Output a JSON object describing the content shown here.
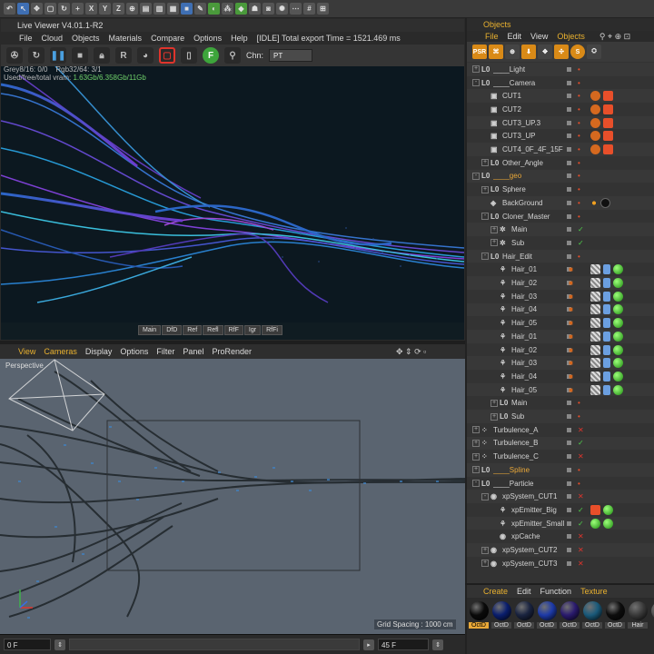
{
  "toolbar": {
    "xyz": [
      "X",
      "Y",
      "Z"
    ]
  },
  "live_viewer": {
    "title": "Live Viewer V4.01.1-R2",
    "menu": [
      "File",
      "Cloud",
      "Objects",
      "Materials",
      "Compare",
      "Options",
      "Help"
    ],
    "status": "[IDLE] Total export Time = 1521.469 ms",
    "channel_label": "Chn:",
    "channel_value": "PT",
    "stats": {
      "line1_a": "Grey8/16: 0/0",
      "line1_b": "Rgb32/64: 3/1",
      "vram_label": "Used/free/total vram:",
      "vram_value": "1.63Gb/6.358Gb/11Gb"
    },
    "tabs": [
      "Main",
      "DfD",
      "Ref",
      "Refl",
      "RfF",
      "Igr",
      "RfFi"
    ]
  },
  "viewport": {
    "menu": [
      "View",
      "Cameras",
      "Display",
      "Options",
      "Filter",
      "Panel",
      "ProRender"
    ],
    "label": "Perspective",
    "grid_spacing": "Grid Spacing : 1000 cm"
  },
  "timeline": {
    "start": "0 F",
    "end": "45 F"
  },
  "objects_panel": {
    "title": "Objects",
    "menu": [
      "File",
      "Edit",
      "View",
      "Objects"
    ],
    "tool_label": "PSR",
    "rows": [
      {
        "indent": 0,
        "exp": "+",
        "icon": "L0",
        "name": "____Light",
        "orange": false,
        "check": "dot",
        "tags": []
      },
      {
        "indent": 0,
        "exp": "-",
        "icon": "L0",
        "name": "____Camera",
        "orange": false,
        "check": "dot",
        "tags": []
      },
      {
        "indent": 1,
        "exp": "",
        "icon": "▣",
        "name": "CUT1",
        "orange": false,
        "check": "dot",
        "tags": [
          "ban",
          "cam"
        ]
      },
      {
        "indent": 1,
        "exp": "",
        "icon": "▣",
        "name": "CUT2",
        "orange": false,
        "check": "dot",
        "tags": [
          "ban",
          "cam"
        ]
      },
      {
        "indent": 1,
        "exp": "",
        "icon": "▣",
        "name": "CUT3_UP.3",
        "orange": false,
        "check": "dot",
        "tags": [
          "ban",
          "cam"
        ]
      },
      {
        "indent": 1,
        "exp": "",
        "icon": "▣",
        "name": "CUT3_UP",
        "orange": false,
        "check": "dot",
        "tags": [
          "ban",
          "cam"
        ]
      },
      {
        "indent": 1,
        "exp": "",
        "icon": "▣",
        "name": "CUT4_0F_4F_15F",
        "orange": false,
        "check": "dot",
        "tags": [
          "ban",
          "cam"
        ]
      },
      {
        "indent": 1,
        "exp": "+",
        "icon": "L0",
        "name": "Other_Angle",
        "orange": false,
        "check": "dot",
        "tags": []
      },
      {
        "indent": 0,
        "exp": "-",
        "icon": "L0",
        "name": "____geo",
        "orange": true,
        "check": "dot",
        "tags": []
      },
      {
        "indent": 1,
        "exp": "+",
        "icon": "L0",
        "name": "Sphere",
        "orange": false,
        "check": "dot",
        "tags": []
      },
      {
        "indent": 1,
        "exp": "",
        "icon": "◈",
        "name": "BackGround",
        "orange": false,
        "check": "dot",
        "tags": [
          "dots",
          "blk"
        ]
      },
      {
        "indent": 1,
        "exp": "-",
        "icon": "L0",
        "name": "Cloner_Master",
        "orange": false,
        "check": "dot",
        "tags": []
      },
      {
        "indent": 2,
        "exp": "+",
        "icon": "✲",
        "name": "Main",
        "orange": false,
        "check": "✓",
        "tags": []
      },
      {
        "indent": 2,
        "exp": "+",
        "icon": "✲",
        "name": "Sub",
        "orange": false,
        "check": "✓",
        "tags": []
      },
      {
        "indent": 1,
        "exp": "-",
        "icon": "L0",
        "name": "Hair_Edit",
        "orange": false,
        "check": "dot",
        "tags": []
      },
      {
        "indent": 2,
        "exp": "",
        "icon": "⚘",
        "name": "Hair_01",
        "orange": false,
        "check": "sq",
        "tags": [
          "hair",
          "blue",
          "gsph"
        ]
      },
      {
        "indent": 2,
        "exp": "",
        "icon": "⚘",
        "name": "Hair_02",
        "orange": false,
        "check": "sq",
        "tags": [
          "hair",
          "blue",
          "gsph"
        ]
      },
      {
        "indent": 2,
        "exp": "",
        "icon": "⚘",
        "name": "Hair_03",
        "orange": false,
        "check": "sq",
        "tags": [
          "hair",
          "blue",
          "gsph"
        ]
      },
      {
        "indent": 2,
        "exp": "",
        "icon": "⚘",
        "name": "Hair_04",
        "orange": false,
        "check": "sq",
        "tags": [
          "hair",
          "blue",
          "gsph"
        ]
      },
      {
        "indent": 2,
        "exp": "",
        "icon": "⚘",
        "name": "Hair_05",
        "orange": false,
        "check": "sq",
        "tags": [
          "hair",
          "blue",
          "gsph"
        ]
      },
      {
        "indent": 2,
        "exp": "",
        "icon": "⚘",
        "name": "Hair_01",
        "orange": false,
        "check": "sq",
        "tags": [
          "hair",
          "blue",
          "gsph"
        ]
      },
      {
        "indent": 2,
        "exp": "",
        "icon": "⚘",
        "name": "Hair_02",
        "orange": false,
        "check": "sq",
        "tags": [
          "hair",
          "blue",
          "gsph"
        ]
      },
      {
        "indent": 2,
        "exp": "",
        "icon": "⚘",
        "name": "Hair_03",
        "orange": false,
        "check": "sq",
        "tags": [
          "hair",
          "blue",
          "gsph"
        ]
      },
      {
        "indent": 2,
        "exp": "",
        "icon": "⚘",
        "name": "Hair_04",
        "orange": false,
        "check": "sq",
        "tags": [
          "hair",
          "blue",
          "gsph"
        ]
      },
      {
        "indent": 2,
        "exp": "",
        "icon": "⚘",
        "name": "Hair_05",
        "orange": false,
        "check": "sq",
        "tags": [
          "hair",
          "blue",
          "gsph"
        ]
      },
      {
        "indent": 2,
        "exp": "+",
        "icon": "L0",
        "name": "Main",
        "orange": false,
        "check": "dot",
        "tags": []
      },
      {
        "indent": 2,
        "exp": "+",
        "icon": "L0",
        "name": "Sub",
        "orange": false,
        "check": "dot",
        "tags": []
      },
      {
        "indent": 0,
        "exp": "+",
        "icon": "⁘",
        "name": "Turbulence_A",
        "orange": false,
        "check": "✕",
        "tags": []
      },
      {
        "indent": 0,
        "exp": "+",
        "icon": "⁘",
        "name": "Turbulence_B",
        "orange": false,
        "check": "✓",
        "tags": []
      },
      {
        "indent": 0,
        "exp": "+",
        "icon": "⁘",
        "name": "Turbulence_C",
        "orange": false,
        "check": "✕",
        "tags": []
      },
      {
        "indent": 0,
        "exp": "+",
        "icon": "L0",
        "name": "____Spline",
        "orange": true,
        "check": "dot",
        "tags": []
      },
      {
        "indent": 0,
        "exp": "-",
        "icon": "L0",
        "name": "____Particle",
        "orange": false,
        "check": "dot",
        "tags": []
      },
      {
        "indent": 1,
        "exp": "-",
        "icon": "◉",
        "name": "xpSystem_CUT1",
        "orange": false,
        "check": "✕",
        "tags": []
      },
      {
        "indent": 2,
        "exp": "",
        "icon": "⚘",
        "name": "xpEmitter_Big",
        "orange": false,
        "check": "✓",
        "tags": [
          "cam",
          "gsph"
        ]
      },
      {
        "indent": 2,
        "exp": "",
        "icon": "⚘",
        "name": "xpEmitter_Small",
        "orange": false,
        "check": "✓",
        "tags": [
          "gsph",
          "gsph"
        ]
      },
      {
        "indent": 2,
        "exp": "",
        "icon": "◉",
        "name": "xpCache",
        "orange": false,
        "check": "✕",
        "tags": []
      },
      {
        "indent": 1,
        "exp": "+",
        "icon": "◉",
        "name": "xpSystem_CUT2",
        "orange": false,
        "check": "✕",
        "tags": []
      },
      {
        "indent": 1,
        "exp": "+",
        "icon": "◉",
        "name": "xpSystem_CUT3",
        "orange": false,
        "check": "✕",
        "tags": []
      }
    ]
  },
  "materials": {
    "menu": [
      "Create",
      "Edit",
      "Function",
      "Texture"
    ],
    "items": [
      {
        "label": "OctD",
        "color": "#0a0a0a",
        "selected": true
      },
      {
        "label": "OctD",
        "color": "#0a1e6e",
        "selected": false
      },
      {
        "label": "OctD",
        "color": "#1a2440",
        "selected": false
      },
      {
        "label": "OctD",
        "color": "#1d3aa8",
        "selected": false
      },
      {
        "label": "OctD",
        "color": "#2a1a6e",
        "selected": false
      },
      {
        "label": "OctD",
        "color": "#1a5a7a",
        "selected": false
      },
      {
        "label": "OctD",
        "color": "#0d0d0d",
        "selected": false
      },
      {
        "label": "Hair",
        "color": "#3a3a3a",
        "selected": false
      },
      {
        "label": "",
        "color": "#555555",
        "selected": false
      }
    ]
  }
}
